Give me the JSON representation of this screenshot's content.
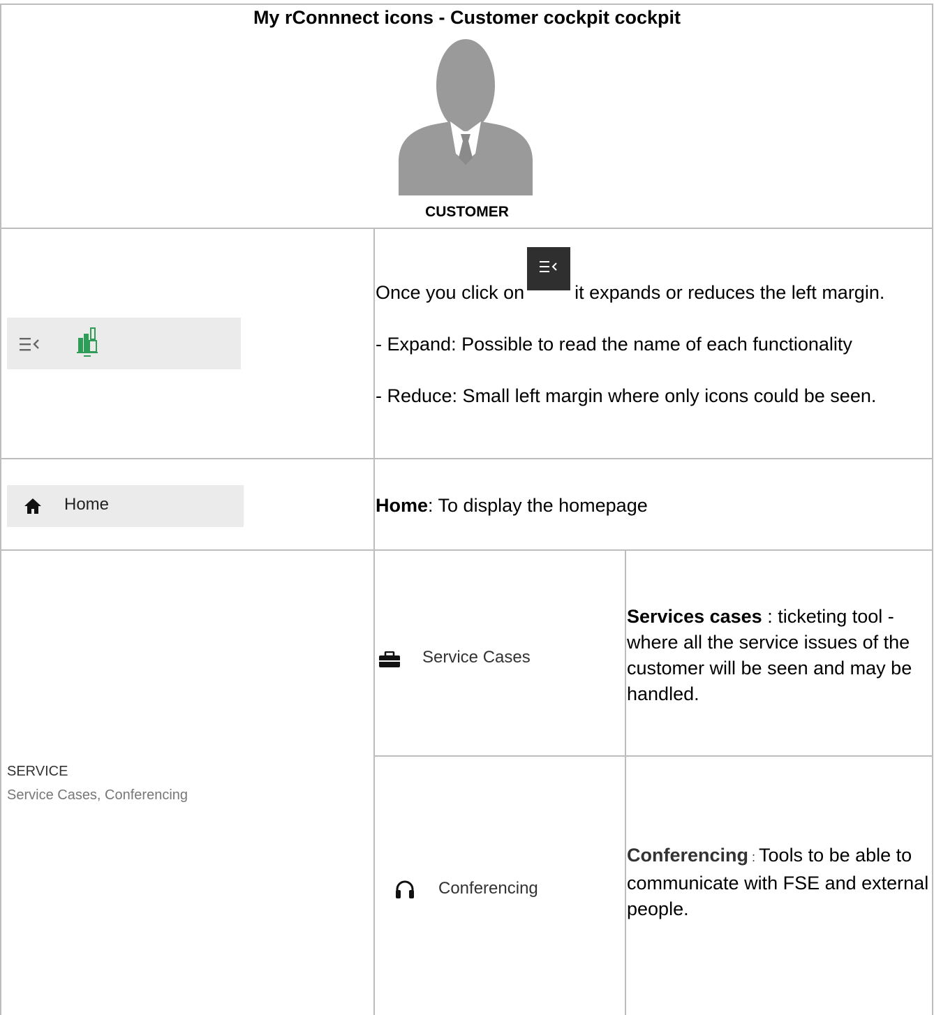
{
  "header": {
    "title": "My rConnnect icons - Customer cockpit cockpit",
    "avatar_label": "CUSTOMER"
  },
  "menu_row": {
    "text_before": "Once you click on",
    "text_after": "it expands or reduces the left margin.",
    "expand": "- Expand: Possible to read the name of each functionality",
    "reduce": "- Reduce: Small left margin where only icons could be seen."
  },
  "home_row": {
    "nav_label": "Home",
    "desc_bold": "Home",
    "desc_rest": ": To display the homepage"
  },
  "service_row": {
    "section_title": "SERVICE",
    "section_subtitle": "Service Cases, Conferencing",
    "items": [
      {
        "nav_label": "Service Cases",
        "desc_bold": "Services cases",
        "desc_rest": " : ticketing tool - where all the service issues of the customer will be seen and may be handled.",
        "icon": "briefcase-icon"
      },
      {
        "nav_label": "Conferencing",
        "desc_bold": "Conferencing",
        "desc_sep": " : ",
        "desc_rest": "Tools to be able to communicate with FSE and external people.",
        "icon": "headphones-icon"
      }
    ]
  },
  "colors": {
    "grid_line": "#bdbdbd",
    "nav_bg": "#ebebeb",
    "accent_green": "#2e9d57",
    "avatar_gray": "#9a9a9a"
  }
}
